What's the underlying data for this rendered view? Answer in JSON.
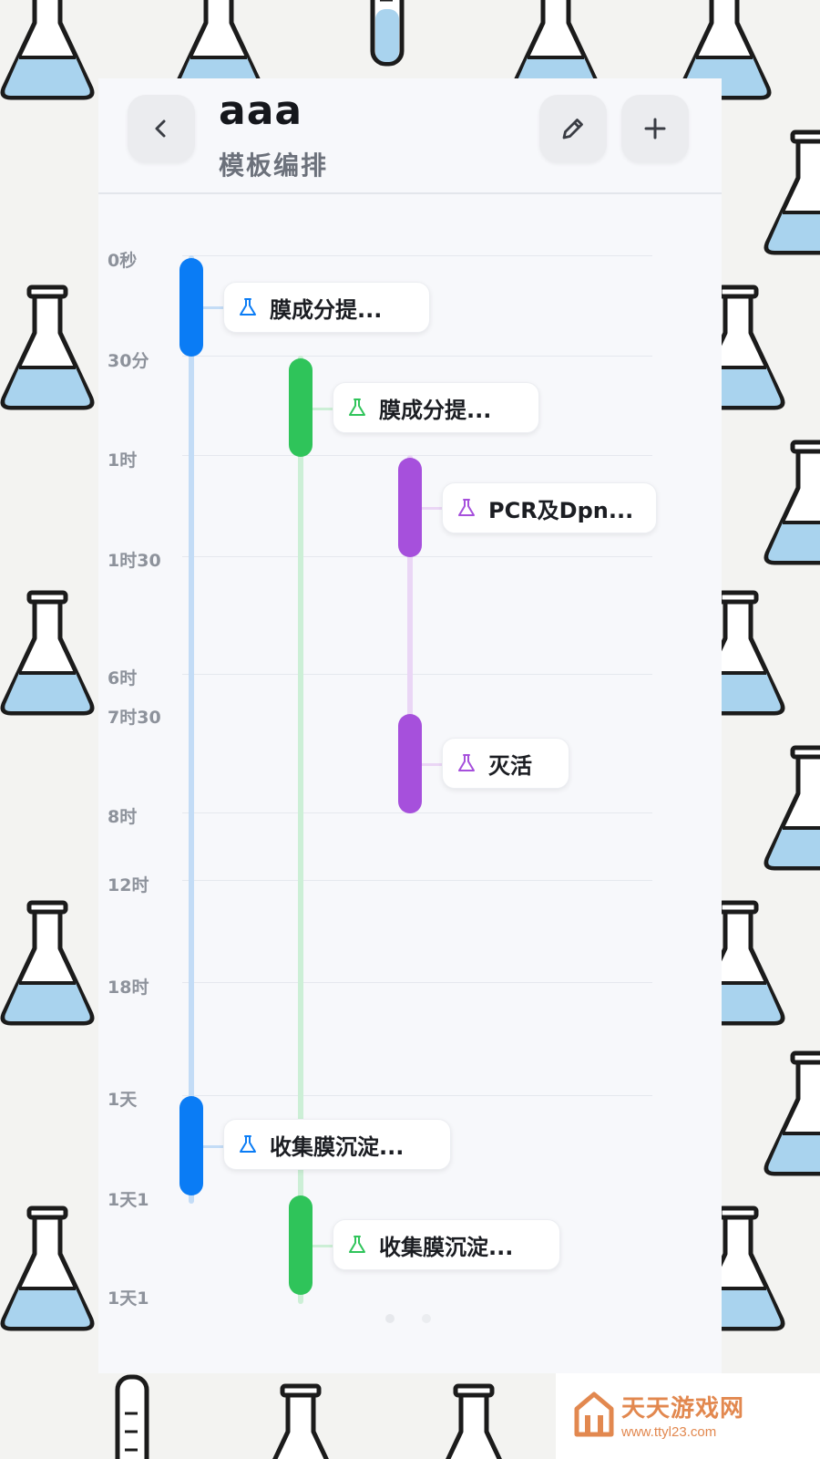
{
  "header": {
    "back_icon": "chevron-left-icon",
    "title": "aaa",
    "subtitle": "模板编排",
    "edit_icon": "pencil-icon",
    "add_icon": "plus-icon"
  },
  "time_axis": [
    "0秒",
    "30分",
    "1时",
    "1时30",
    "6时",
    "7时30",
    "8时",
    "12时",
    "18时",
    "1天",
    "1天1",
    "1天1"
  ],
  "steps": [
    {
      "label": "膜成分提...",
      "lane": "blue",
      "icon": "flask-icon"
    },
    {
      "label": "膜成分提...",
      "lane": "green",
      "icon": "flask-icon"
    },
    {
      "label": "PCR及Dpn...",
      "lane": "purple",
      "icon": "flask-icon"
    },
    {
      "label": "灭活",
      "lane": "purple",
      "icon": "flask-icon"
    },
    {
      "label": "收集膜沉淀...",
      "lane": "blue",
      "icon": "flask-icon"
    },
    {
      "label": "收集膜沉淀...",
      "lane": "green",
      "icon": "flask-icon"
    }
  ],
  "colors": {
    "blue": "#0a7cf5",
    "green": "#2fc45a",
    "purple": "#a650dc",
    "blue_light": "#c3dcf6",
    "green_light": "#ccefd6",
    "purple_light": "#ead6f5"
  },
  "watermark": {
    "title": "天天游戏网",
    "url": "www.ttyl23.com"
  }
}
